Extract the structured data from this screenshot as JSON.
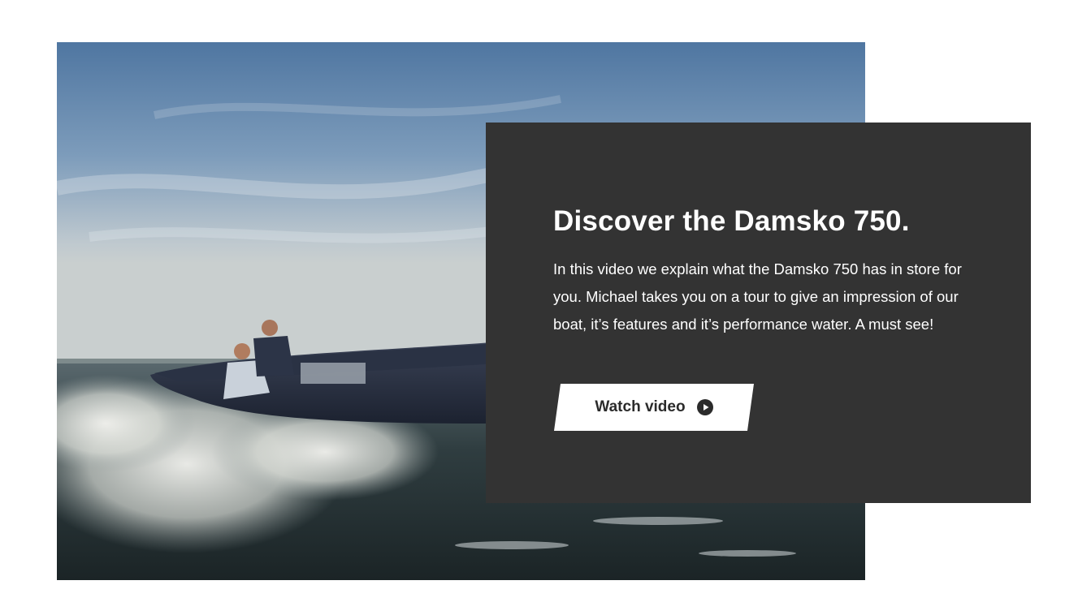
{
  "card": {
    "title": "Discover the Damsko 750.",
    "description": "In this video we explain what the Damsko 750 has in store for you. Michael takes you on a tour to give an impression of our boat, it’s features and it’s performance water. A must see!",
    "button_label": "Watch video",
    "button_icon": "play-circle-icon"
  },
  "photo": {
    "subject": "boat-on-water"
  },
  "colors": {
    "card_background": "#333333",
    "button_background": "#ffffff",
    "text_on_card": "#ffffff",
    "button_text": "#2b2b2b"
  }
}
